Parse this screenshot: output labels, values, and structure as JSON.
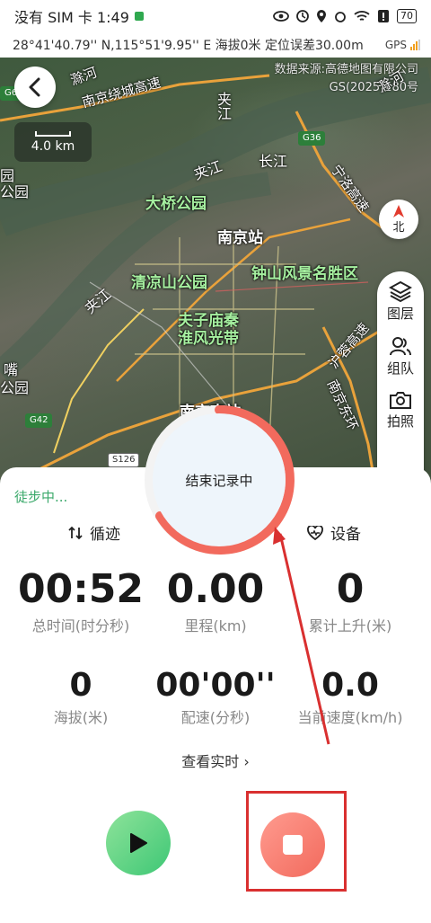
{
  "status_bar": {
    "carrier_time": "没有 SIM 卡 1:49",
    "battery": "70"
  },
  "gps_bar": {
    "info": "28°41'40.79'' N,115°51'9.95'' E 海拔0米 定位误差30.00m",
    "gps_label": "GPS"
  },
  "map": {
    "source_line1": "数据来源:高德地图有限公司",
    "source_line2": "GS(2025)180号",
    "scale": "4.0 km",
    "compass": "北",
    "labels": {
      "yangtze_top": "长江",
      "jiajiang_1": "夹江",
      "jiajiang_2": "夹江",
      "jiajiang_3": "夹江",
      "daqiao": "大桥公园",
      "nanjing_station": "南京站",
      "qingliang": "清凉山公园",
      "zhongshan": "钟山风景名胜区",
      "fuzimiao": "夫子庙秦",
      "huaifeng": "淮风光带",
      "nanjing_south": "南京南站",
      "nanjing_ring": "南京绕城高速",
      "ningluo": "宁洛高速",
      "hu_rong": "沪蓉高速",
      "nanjing_dong": "南京东环",
      "left_1": "园",
      "left_2": "公园",
      "left_3": "嘴",
      "left_4": "公园",
      "top_left": "滁河",
      "top_right": "滁河"
    },
    "shields": {
      "g36": "G36",
      "g42": "G42",
      "s126": "S126",
      "g6": "G6"
    },
    "side_buttons": {
      "layers": "图层",
      "team": "组队",
      "photo": "拍照"
    }
  },
  "panel": {
    "status": "徒步中...",
    "tab_track": "循迹",
    "tab_device": "设备",
    "stats": [
      {
        "value": "00:52",
        "label": "总时间(时分秒)"
      },
      {
        "value": "0.00",
        "label": "里程(km)"
      },
      {
        "value": "0",
        "label": "累计上升(米)"
      },
      {
        "value": "0",
        "label": "海拔(米)"
      },
      {
        "value": "00'00''",
        "label": "配速(分秒)"
      },
      {
        "value": "0.0",
        "label": "当前速度(km/h)"
      }
    ],
    "realtime": "查看实时",
    "ring_label": "结束记录中"
  },
  "colors": {
    "accent_green": "#3aa86a",
    "stop_red": "#f26a5d",
    "annotation": "#d93030"
  }
}
